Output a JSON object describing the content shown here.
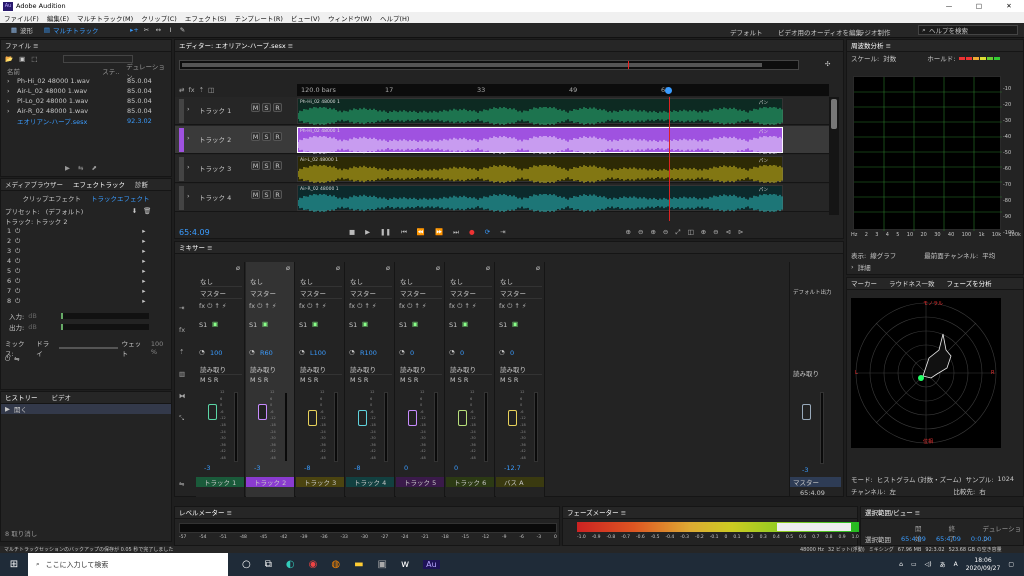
{
  "app": {
    "title": "Adobe Audition",
    "icon": "Au"
  },
  "window": {
    "minimize": "—",
    "maximize": "□",
    "close": "✕"
  },
  "menu": [
    "ファイル(F)",
    "編集(E)",
    "マルチトラック(M)",
    "クリップ(C)",
    "エフェクト(S)",
    "テンプレート(R)",
    "ビュー(V)",
    "ウィンドウ(W)",
    "ヘルプ(H)"
  ],
  "toolbar": {
    "mode_waveform": "波形",
    "mode_multitrack": "マルチトラック",
    "workspaces": [
      "デフォルト",
      "ビデオ用のオーディオを編集",
      "ラジオ制作"
    ],
    "search_placeholder": "ヘルプを検索"
  },
  "files": {
    "title": "ファイル",
    "col_name": "名前",
    "col_status": "ステ..",
    "col_duration": "デュレーション",
    "items": [
      {
        "name": "Ph-Hi_02 48000 1.wav",
        "duration": "85.0.04"
      },
      {
        "name": "Air-L_02 48000 1.wav",
        "duration": "85.0.04"
      },
      {
        "name": "Pl-Lo_02 48000 1.wav",
        "duration": "85.0.04"
      },
      {
        "name": "Air-R_02 48000 1.wav",
        "duration": "85.0.04"
      },
      {
        "name": "エオリアン-ハープ.sesx",
        "duration": "92.3.02"
      }
    ]
  },
  "effects": {
    "tabs": [
      "メディアブラウザー",
      "エフェクトラック",
      "診断"
    ],
    "sub_tabs": [
      "クリップエフェクト",
      "トラックエフェクト"
    ],
    "preset_label": "プリセット:",
    "preset_value": "(デフォルト)",
    "track_label": "トラック: トラック 2",
    "slots": [
      "1",
      "2",
      "3",
      "4",
      "5",
      "6",
      "7",
      "8"
    ],
    "input_label": "入力:",
    "output_label": "出力:",
    "db": "dB",
    "mix_label": "ミックス:",
    "mix_dry": "ドライ",
    "mix_wet": "ウェット",
    "mix_pct": "100 %",
    "status_text": "8 取り消し"
  },
  "history": {
    "tabs": [
      "ヒストリー",
      "ビデオ"
    ],
    "items": [
      "開く"
    ]
  },
  "editor": {
    "title": "エディター: エオリアン-ハープ.sesx",
    "timecode": "65:4.09",
    "ruler_start": "120.0 bars",
    "ruler": [
      "17",
      "33",
      "49",
      "65"
    ],
    "tracks": [
      {
        "name": "トラック 1",
        "clip": "Ph-Hi_02 48000 1",
        "color": "#2dbf7c",
        "sel": false
      },
      {
        "name": "トラック 2",
        "clip": "Ph-Hi_02 48000 1",
        "color": "#9f52e0",
        "sel": true
      },
      {
        "name": "トラック 3",
        "clip": "Air-L_02 48000 1",
        "color": "#d6c421",
        "sel": false
      },
      {
        "name": "トラック 4",
        "clip": "Air-R_02 48000 1",
        "color": "#2ec2c2",
        "sel": false
      }
    ],
    "pan": "パン",
    "msr": [
      "M",
      "S",
      "R"
    ]
  },
  "mixer": {
    "title": "ミキサー",
    "input": "なし",
    "output": "マスター",
    "master_output": "デフォルト出力",
    "mode": "読み取り",
    "send": "S1",
    "strips": [
      {
        "name": "トラック 1",
        "pan": "100",
        "vol": "-3",
        "color": "#5bd6a6",
        "bar": "#1a5a3a"
      },
      {
        "name": "トラック 2",
        "pan": "R60",
        "vol": "-3",
        "color": "#c78bff",
        "bar": "#8a3bd0"
      },
      {
        "name": "トラック 3",
        "pan": "L100",
        "vol": "-8",
        "color": "#e8d25a",
        "bar": "#4b4410"
      },
      {
        "name": "トラック 4",
        "pan": "R100",
        "vol": "-8",
        "color": "#5fd3dd",
        "bar": "#124040"
      },
      {
        "name": "トラック 5",
        "pan": "0",
        "vol": "0",
        "color": "#c78bff",
        "bar": "#3a1a4a"
      },
      {
        "name": "トラック 6",
        "pan": "0",
        "vol": "0",
        "color": "#b8e07a",
        "bar": "#2c3a14"
      },
      {
        "name": "バス A",
        "pan": "0",
        "vol": "-12.7",
        "color": "#e8d25a",
        "bar": "#3a3a10"
      }
    ],
    "master": {
      "name": "マスター",
      "vol": "-3",
      "time": "65:4.09"
    },
    "scale": [
      "12",
      "6",
      "0",
      "-6",
      "-12",
      "-18",
      "-24",
      "-30",
      "-36",
      "-42",
      "-48"
    ]
  },
  "spectrum": {
    "title": "周波数分析",
    "scale_label": "スケール:",
    "scale_value": "対数",
    "hold_label": "ホールド:",
    "db_ticks": [
      "-10",
      "-20",
      "-30",
      "-40",
      "-50",
      "-60",
      "-70",
      "-80",
      "-90",
      "-100"
    ],
    "hz": [
      "Hz",
      "2",
      "3",
      "4",
      "5",
      "10",
      "20",
      "30",
      "40",
      "100",
      "1k",
      "10k",
      "100k"
    ],
    "display_label": "表示:",
    "display_value": "線グラフ",
    "channel_label": "最前面チャンネル:",
    "channel_value": "平均",
    "detail": "詳細"
  },
  "phase": {
    "tabs": [
      "マーカー",
      "ラウドネス一致",
      "フェーズを分析"
    ],
    "label_top": "モノラル",
    "label_bottom": "位相",
    "left": "L",
    "right": "R",
    "mode_label": "モード:",
    "mode_value": "ヒストグラム (対数・ズーム)",
    "sample_label": "サンプル:",
    "sample_value": "1024",
    "channel_label": "チャンネル:",
    "channel_value": "左",
    "ratio_label": "比較先:",
    "ratio_value": "右"
  },
  "levels": {
    "title": "レベルメーター",
    "ticks": [
      "-57",
      "-54",
      "-51",
      "-48",
      "-45",
      "-42",
      "-39",
      "-36",
      "-33",
      "-30",
      "-27",
      "-24",
      "-21",
      "-18",
      "-15",
      "-12",
      "-9",
      "-6",
      "-3",
      "0"
    ]
  },
  "phase_meter": {
    "title": "フェーズメーター",
    "ticks": [
      "-1.0",
      "-0.9",
      "-0.8",
      "-0.7",
      "-0.6",
      "-0.5",
      "-0.4",
      "-0.3",
      "-0.2",
      "-0.1",
      "0",
      "0.1",
      "0.2",
      "0.3",
      "0.4",
      "0.5",
      "0.6",
      "0.7",
      "0.8",
      "0.9",
      "1.0"
    ]
  },
  "selection": {
    "title": "選択範囲/ビュー",
    "cols": [
      "開始",
      "終了",
      "デュレーション"
    ],
    "rows": [
      {
        "label": "選択範囲",
        "start": "65:4.09",
        "end": "65:4.09",
        "dur": "0:0.00"
      }
    ]
  },
  "status": {
    "left": "マルチトラックセッションのバックアップの保存が 0.05 秒で完了しました",
    "rate": "48000 Hz",
    "bits": "32 ビット(浮動)",
    "mix": "ミキシング",
    "mem": "67.96 MB",
    "dur": "92:3.02",
    "free": "523.68 GB の空き容量"
  },
  "taskbar": {
    "search": "ここに入力して検索",
    "time": "18:06",
    "date": "2020/09/27",
    "ime": "A",
    "lang": "あ"
  }
}
